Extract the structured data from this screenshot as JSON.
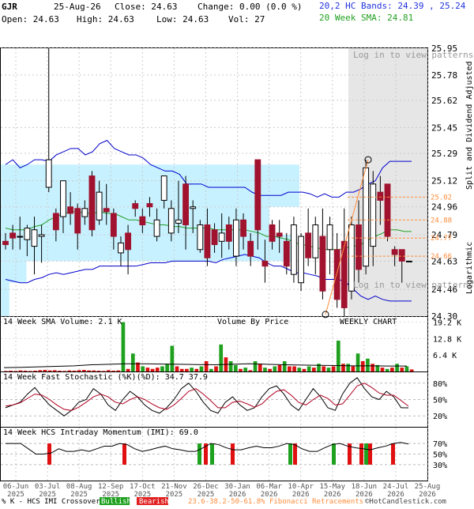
{
  "header": {
    "symbol": "GJR",
    "date": "25-Aug-26",
    "close_label": "Close: 24.63",
    "change_label": "Change: 0.00 (0.0 %)",
    "open_label": "Open: 24.63",
    "high_label": "High: 24.63",
    "low_label": "Low: 24.63",
    "vol_label": "Vol: 27",
    "bands_label": "20,2 HC Bands: 24.39 , 25.24",
    "sma_label": "20 Week SMA: 24.81"
  },
  "colors": {
    "up": "#1fa11f",
    "down": "#a0122e",
    "band": "#0000cc",
    "sma": "#22a022",
    "vbp": "#c7f1ff",
    "fib": "#ff8c3a",
    "stoch_fast": "#000000",
    "stoch_slow": "#b00020"
  },
  "chart_data": [
    {
      "type": "candlestick",
      "panel": "price",
      "title": "",
      "scale": "log",
      "ylim": [
        24.3,
        25.95
      ],
      "y_ticks": [
        "25.95",
        "25.78",
        "25.62",
        "25.45",
        "25.29",
        "25.12",
        "24.96",
        "24.79",
        "24.63",
        "24.46",
        "24.30"
      ],
      "y_axis_label": "Split and Dividend Adjusted",
      "y_axis_label_bottom": "Logarithmic",
      "x_ticks": [
        "06-Jun 2025",
        "03-Jul 2025",
        "08-Aug 2025",
        "12-Sep 2025",
        "17-Oct 2025",
        "21-Nov 2025",
        "26-Dec 2025",
        "30-Jan 2026",
        "06-Mar 2026",
        "10-Apr 2026",
        "15-May 2026",
        "18-Jun 2026",
        "24-Jul 2026",
        "25-Aug 2026"
      ],
      "candles": [
        {
          "o": 24.75,
          "h": 24.8,
          "l": 24.7,
          "c": 24.73
        },
        {
          "o": 24.8,
          "h": 24.85,
          "l": 24.7,
          "c": 24.77
        },
        {
          "o": 24.78,
          "h": 24.9,
          "l": 24.7,
          "c": 24.78
        },
        {
          "o": 24.76,
          "h": 24.85,
          "l": 24.66,
          "c": 24.83
        },
        {
          "o": 24.72,
          "h": 24.9,
          "l": 24.55,
          "c": 24.82
        },
        {
          "o": 24.78,
          "h": 24.85,
          "l": 24.62,
          "c": 24.79
        },
        {
          "o": 25.08,
          "h": 25.95,
          "l": 25.05,
          "c": 25.25
        },
        {
          "o": 24.92,
          "h": 24.95,
          "l": 24.75,
          "c": 24.82
        },
        {
          "o": 24.9,
          "h": 25.0,
          "l": 24.8,
          "c": 25.12
        },
        {
          "o": 24.96,
          "h": 25.05,
          "l": 24.85,
          "c": 24.92
        },
        {
          "o": 24.95,
          "h": 24.98,
          "l": 24.7,
          "c": 24.8
        },
        {
          "o": 24.9,
          "h": 25.0,
          "l": 24.85,
          "c": 24.95
        },
        {
          "o": 25.15,
          "h": 25.18,
          "l": 24.78,
          "c": 24.82
        },
        {
          "o": 24.88,
          "h": 25.12,
          "l": 24.85,
          "c": 25.05
        },
        {
          "o": 24.95,
          "h": 25.1,
          "l": 24.85,
          "c": 24.93
        },
        {
          "o": 24.92,
          "h": 24.95,
          "l": 24.7,
          "c": 24.78
        },
        {
          "o": 24.68,
          "h": 24.78,
          "l": 24.6,
          "c": 24.74
        },
        {
          "o": 24.8,
          "h": 24.85,
          "l": 24.55,
          "c": 24.7
        },
        {
          "o": 24.98,
          "h": 25.0,
          "l": 24.9,
          "c": 24.95
        },
        {
          "o": 24.9,
          "h": 24.95,
          "l": 24.8,
          "c": 24.85
        },
        {
          "o": 24.98,
          "h": 25.02,
          "l": 24.9,
          "c": 24.96
        },
        {
          "o": 24.78,
          "h": 24.95,
          "l": 24.75,
          "c": 24.88
        },
        {
          "o": 25.0,
          "h": 25.15,
          "l": 24.95,
          "c": 25.15
        },
        {
          "o": 24.8,
          "h": 25.0,
          "l": 24.75,
          "c": 24.95
        },
        {
          "o": 24.86,
          "h": 25.12,
          "l": 24.8,
          "c": 24.88
        },
        {
          "o": 25.1,
          "h": 25.15,
          "l": 24.7,
          "c": 24.85
        },
        {
          "o": 24.95,
          "h": 25.0,
          "l": 24.8,
          "c": 24.96
        },
        {
          "o": 24.7,
          "h": 24.88,
          "l": 24.68,
          "c": 24.85
        },
        {
          "o": 24.85,
          "h": 24.95,
          "l": 24.6,
          "c": 24.65
        },
        {
          "o": 24.82,
          "h": 24.86,
          "l": 24.68,
          "c": 24.73
        },
        {
          "o": 24.75,
          "h": 24.92,
          "l": 24.65,
          "c": 24.8
        },
        {
          "o": 24.85,
          "h": 24.9,
          "l": 24.7,
          "c": 24.75
        },
        {
          "o": 24.66,
          "h": 24.95,
          "l": 24.6,
          "c": 24.88
        },
        {
          "o": 24.88,
          "h": 24.92,
          "l": 24.7,
          "c": 24.78
        },
        {
          "o": 24.75,
          "h": 24.8,
          "l": 24.6,
          "c": 24.66
        },
        {
          "o": 25.25,
          "h": 25.25,
          "l": 24.7,
          "c": 24.82
        },
        {
          "o": 24.63,
          "h": 24.76,
          "l": 24.5,
          "c": 24.6
        },
        {
          "o": 24.85,
          "h": 24.88,
          "l": 24.7,
          "c": 24.75
        },
        {
          "o": 24.8,
          "h": 24.88,
          "l": 24.68,
          "c": 24.78
        },
        {
          "o": 24.75,
          "h": 24.8,
          "l": 24.55,
          "c": 24.6
        },
        {
          "o": 24.55,
          "h": 24.9,
          "l": 24.5,
          "c": 24.85
        },
        {
          "o": 24.5,
          "h": 24.8,
          "l": 24.45,
          "c": 24.78
        },
        {
          "o": 24.8,
          "h": 24.95,
          "l": 24.6,
          "c": 24.65
        },
        {
          "o": 24.65,
          "h": 24.9,
          "l": 24.55,
          "c": 24.85
        },
        {
          "o": 24.78,
          "h": 24.95,
          "l": 24.4,
          "c": 24.45
        },
        {
          "o": 24.7,
          "h": 24.9,
          "l": 24.55,
          "c": 24.85
        },
        {
          "o": 24.7,
          "h": 24.8,
          "l": 24.35,
          "c": 24.4
        },
        {
          "o": 24.75,
          "h": 24.95,
          "l": 24.3,
          "c": 24.35
        },
        {
          "o": 24.45,
          "h": 24.9,
          "l": 24.4,
          "c": 24.85
        },
        {
          "o": 24.85,
          "h": 25.0,
          "l": 24.5,
          "c": 24.58
        },
        {
          "o": 24.6,
          "h": 25.25,
          "l": 24.55,
          "c": 25.2
        },
        {
          "o": 24.72,
          "h": 25.18,
          "l": 24.6,
          "c": 25.1
        },
        {
          "o": 25.05,
          "h": 25.15,
          "l": 24.85,
          "c": 25.0
        },
        {
          "o": 25.1,
          "h": 25.1,
          "l": 24.75,
          "c": 24.78
        },
        {
          "o": 24.7,
          "h": 24.72,
          "l": 24.6,
          "c": 24.67
        },
        {
          "o": 24.7,
          "h": 24.7,
          "l": 24.5,
          "c": 24.63
        },
        {
          "o": 24.63,
          "h": 24.63,
          "l": 24.63,
          "c": 24.63
        }
      ],
      "upper_band": [
        25.22,
        25.25,
        25.2,
        25.22,
        25.25,
        25.25,
        25.24,
        25.28,
        25.3,
        25.32,
        25.32,
        25.28,
        25.3,
        25.35,
        25.37,
        25.32,
        25.3,
        25.28,
        25.28,
        25.26,
        25.22,
        25.2,
        25.18,
        25.18,
        25.16,
        25.1,
        25.1,
        25.1,
        25.08,
        25.08,
        25.08,
        25.08,
        25.08,
        25.08,
        25.05,
        25.03,
        25.03,
        25.03,
        25.03,
        25.05,
        25.05,
        25.05,
        25.04,
        25.02,
        25.04,
        25.02,
        25.02,
        25.05,
        25.05,
        25.07,
        25.1,
        25.12,
        25.2,
        25.24,
        25.24,
        25.24,
        25.24
      ],
      "lower_band": [
        24.52,
        24.51,
        24.5,
        24.5,
        24.52,
        24.53,
        24.55,
        24.56,
        24.55,
        24.56,
        24.57,
        24.58,
        24.58,
        24.6,
        24.6,
        24.6,
        24.6,
        24.6,
        24.6,
        24.61,
        24.62,
        24.62,
        24.62,
        24.63,
        24.63,
        24.63,
        24.63,
        24.63,
        24.63,
        24.62,
        24.64,
        24.65,
        24.66,
        24.67,
        24.66,
        24.65,
        24.62,
        24.6,
        24.6,
        24.58,
        24.56,
        24.56,
        24.55,
        24.54,
        24.52,
        24.52,
        24.52,
        24.5,
        24.46,
        24.42,
        24.4,
        24.42,
        24.4,
        24.39,
        24.39,
        24.39,
        24.39
      ],
      "sma": [
        24.83,
        24.82,
        24.82,
        24.82,
        24.84,
        24.85,
        24.88,
        24.9,
        24.92,
        24.93,
        24.93,
        24.92,
        24.92,
        24.93,
        24.92,
        24.92,
        24.9,
        24.88,
        24.88,
        24.87,
        24.86,
        24.85,
        24.85,
        24.84,
        24.84,
        24.83,
        24.83,
        24.83,
        24.83,
        24.82,
        24.82,
        24.82,
        24.82,
        24.82,
        24.81,
        24.8,
        24.78,
        24.78,
        24.77,
        24.76,
        24.74,
        24.73,
        24.72,
        24.71,
        24.7,
        24.7,
        24.7,
        24.71,
        24.72,
        24.73,
        24.76,
        24.78,
        24.8,
        24.82,
        24.82,
        24.81,
        24.81
      ],
      "fibonacci": {
        "levels": [
          "25.02",
          "24.88",
          "24.77",
          "24.66"
        ],
        "label": "23.6-38.2-50-61.8% Fibonacci Retracements"
      },
      "annotations": {
        "pattern_top": "Log in to view patterns in this area",
        "pattern_bottom": "Log in to view patterns in this area"
      }
    },
    {
      "type": "bar",
      "panel": "volume",
      "title": "14 Week SMA Volume: 2.1 K",
      "center_label": "Volume By Price",
      "right_label": "WEEKLY CHART",
      "y_ticks": [
        "19.2 K",
        "12.8 K",
        "6.4 K"
      ],
      "ylim": [
        0,
        20
      ],
      "values": [
        0.2,
        0.3,
        0.2,
        0.4,
        0.3,
        0.2,
        0.3,
        0.5,
        0.6,
        0.4,
        0.5,
        0.3,
        0.2,
        0.4,
        0.3,
        0.5,
        0.6,
        0.4,
        0.4,
        0.3,
        0.2,
        0.5,
        0.3,
        0.4,
        19.2,
        1.0,
        7.0,
        3.5,
        2.0,
        1.5,
        1.0,
        1.5,
        2.0,
        3.0,
        10.0,
        2.0,
        1.0,
        1.0,
        1.5,
        1.0,
        2.0,
        4.0,
        1.0,
        2.0,
        10.5,
        5.5,
        4.0,
        2.5,
        1.0,
        1.5,
        0.5,
        4.0,
        3.0,
        1.5,
        1.0,
        2.0,
        2.5,
        4.0,
        2.0,
        2.0,
        1.5,
        1.0,
        2.0,
        1.5,
        3.0,
        2.0,
        1.5,
        2.0,
        12.0,
        3.0,
        3.0,
        2.0,
        7.0,
        4.0,
        5.0,
        3.0,
        2.5,
        1.5,
        1.0,
        1.5,
        3.0,
        1.5,
        2.0,
        0.8
      ],
      "up": [
        false,
        false,
        false,
        false,
        false,
        false,
        false,
        false,
        false,
        false,
        false,
        false,
        false,
        false,
        false,
        false,
        false,
        false,
        false,
        false,
        false,
        false,
        false,
        false,
        true,
        false,
        true,
        false,
        true,
        false,
        false,
        false,
        true,
        true,
        true,
        false,
        false,
        false,
        true,
        false,
        true,
        false,
        true,
        false,
        true,
        false,
        true,
        true,
        false,
        true,
        false,
        true,
        false,
        true,
        false,
        true,
        false,
        true,
        false,
        false,
        true,
        false,
        true,
        false,
        true,
        false,
        true,
        false,
        true,
        false,
        true,
        false,
        true,
        false,
        true,
        false,
        true,
        false,
        true,
        false,
        true,
        false,
        true,
        false
      ],
      "sma14": [
        1.5,
        1.6,
        1.8,
        2.0,
        2.2,
        2.6,
        2.8,
        3.0,
        3.0,
        2.9,
        2.8,
        2.7,
        2.6,
        2.8,
        3.0,
        2.8,
        2.6,
        2.5,
        2.4,
        2.3,
        2.2,
        2.2,
        2.1,
        2.1
      ]
    },
    {
      "type": "line",
      "panel": "stochastic",
      "title": "14 Week Fast Stochastic (%K)(%D): 34.7 37.9",
      "y_ticks": [
        "80%",
        "50%",
        "20%"
      ],
      "ylim": [
        0,
        100
      ],
      "series": [
        {
          "values": [
            35,
            40,
            45,
            60,
            72,
            55,
            40,
            30,
            20,
            30,
            45,
            50,
            70,
            60,
            40,
            30,
            50,
            65,
            55,
            40,
            30,
            25,
            35,
            50,
            70,
            80,
            65,
            45,
            30,
            25,
            45,
            55,
            40,
            30,
            35,
            55,
            70,
            75,
            60,
            40,
            30,
            50,
            70,
            55,
            35,
            30,
            60,
            80,
            90,
            70,
            55,
            50,
            65,
            55,
            35,
            34.7
          ]
        },
        {
          "values": [
            38,
            40,
            44,
            52,
            60,
            58,
            50,
            40,
            32,
            30,
            36,
            45,
            55,
            60,
            55,
            45,
            42,
            50,
            55,
            50,
            42,
            35,
            32,
            40,
            52,
            65,
            70,
            60,
            48,
            35,
            35,
            45,
            47,
            42,
            36,
            42,
            55,
            65,
            68,
            58,
            45,
            40,
            50,
            58,
            52,
            40,
            42,
            58,
            75,
            80,
            72,
            62,
            58,
            58,
            48,
            37.9
          ]
        }
      ]
    },
    {
      "type": "bar",
      "panel": "imi",
      "title": "14 Week HCS Intraday Momentum (IMI): 69.0",
      "y_ticks": [
        "70%",
        "50%",
        "30%"
      ],
      "ylim": [
        0,
        100
      ],
      "bullish_bearish_label": "% K - HCS IMI Crossover",
      "bullish_label": "Bullish",
      "bearish_label": "Bearish",
      "line": [
        70,
        70,
        70,
        60,
        50,
        50,
        52,
        60,
        55,
        55,
        58,
        55,
        60,
        65,
        65,
        70,
        68,
        60,
        55,
        58,
        62,
        65,
        60,
        58,
        55,
        55,
        62,
        70,
        68,
        62,
        58,
        58,
        62,
        65,
        62,
        62,
        65,
        70,
        68,
        60,
        55,
        55,
        62,
        68,
        70,
        65,
        62,
        60,
        58,
        62,
        65,
        70,
        72,
        69
      ]
    }
  ],
  "footer": {
    "watermark": "©HotCandlestick.com"
  }
}
